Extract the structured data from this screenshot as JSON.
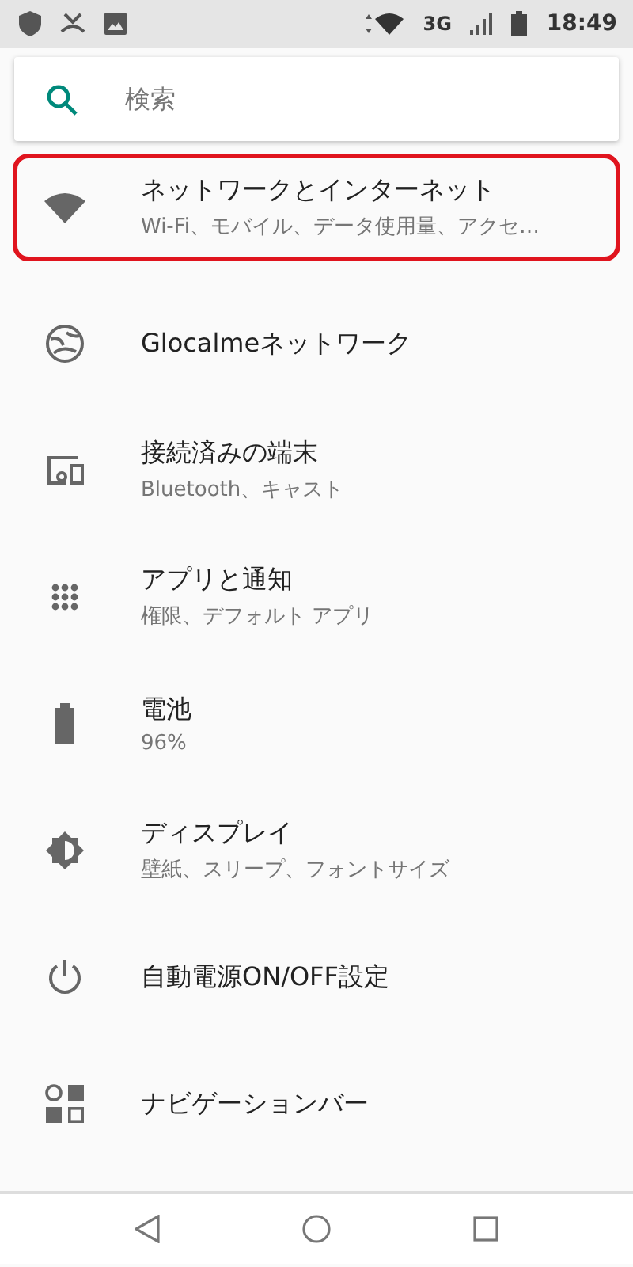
{
  "status_bar": {
    "network": "3G",
    "time": "18:49"
  },
  "search": {
    "placeholder": "検索"
  },
  "settings": [
    {
      "kind": "wifi",
      "title": "ネットワークとインターネット",
      "subtitle": "Wi-Fi、モバイル、データ使用量、アクセ…",
      "highlighted": true
    },
    {
      "kind": "globe",
      "title": "Glocalmeネットワーク",
      "highlighted": false
    },
    {
      "kind": "devices",
      "title": "接続済みの端末",
      "subtitle": "Bluetooth、キャスト",
      "highlighted": false
    },
    {
      "kind": "apps",
      "title": "アプリと通知",
      "subtitle": "権限、デフォルト アプリ",
      "highlighted": false
    },
    {
      "kind": "battery",
      "title": "電池",
      "subtitle": "96%",
      "highlighted": false
    },
    {
      "kind": "display",
      "title": "ディスプレイ",
      "subtitle": "壁紙、スリープ、フォントサイズ",
      "highlighted": false
    },
    {
      "kind": "power",
      "title": "自動電源ON/OFF設定",
      "highlighted": false
    },
    {
      "kind": "navigation",
      "title": "ナビゲーションバー",
      "highlighted": false
    }
  ]
}
